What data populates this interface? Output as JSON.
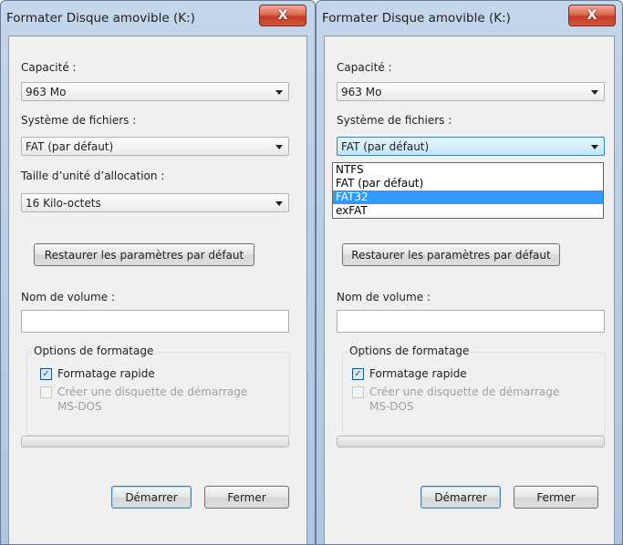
{
  "left_dialog": {
    "title": "Formater Disque amovible (K:)",
    "close_label": "X",
    "capacity_label": "Capacité :",
    "capacity_value": "963 Mo",
    "filesystem_label": "Système de fichiers :",
    "filesystem_value": "FAT (par défaut)",
    "allocation_label": "Taille d’unité d’allocation :",
    "allocation_value": "16 Kilo-octets",
    "restore_button": "Restaurer les paramètres par défaut",
    "volume_label": "Nom de volume :",
    "volume_value": "",
    "options_title": "Options de formatage",
    "quick_format_label": "Formatage rapide",
    "quick_format_checked": true,
    "msdos_label_line1": "Créer une disquette de démarrage",
    "msdos_label_line2": "MS-DOS",
    "start_button": "Démarrer",
    "close_button": "Fermer"
  },
  "right_dialog": {
    "title": "Formater Disque amovible (K:)",
    "close_label": "X",
    "capacity_label": "Capacité :",
    "capacity_value": "963 Mo",
    "filesystem_label": "Système de fichiers :",
    "filesystem_value": "FAT (par défaut)",
    "filesystem_options": [
      "NTFS",
      "FAT (par défaut)",
      "FAT32",
      "exFAT"
    ],
    "filesystem_highlighted": "FAT32",
    "restore_button": "Restaurer les paramètres par défaut",
    "volume_label": "Nom de volume :",
    "volume_value": "",
    "options_title": "Options de formatage",
    "quick_format_label": "Formatage rapide",
    "quick_format_checked": true,
    "msdos_label_line1": "Créer une disquette de démarrage",
    "msdos_label_line2": "MS-DOS",
    "start_button": "Démarrer",
    "close_button": "Fermer"
  },
  "colors": {
    "selection_highlight": "#3399ff",
    "window_frame": "#b9cfe6",
    "close_button": "#c43c23"
  }
}
